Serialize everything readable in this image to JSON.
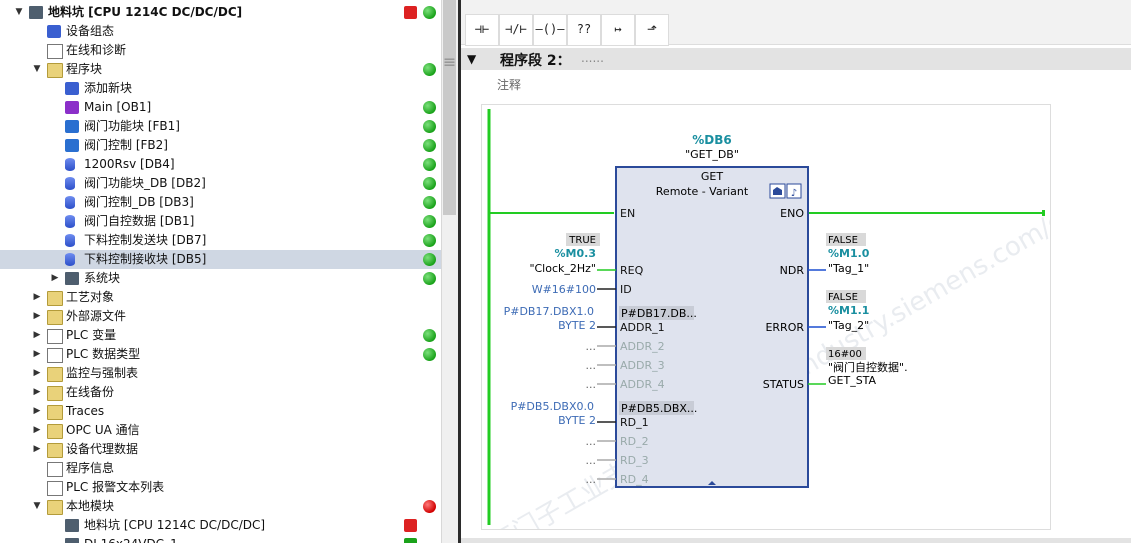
{
  "tree": {
    "items": [
      {
        "label": "地料坑 [CPU 1214C DC/DC/DC]",
        "bold": true,
        "indent": 0,
        "expand": "open",
        "icon": "cpu-icon",
        "status": "green",
        "extra": "download-icon"
      },
      {
        "label": "设备组态",
        "indent": 1,
        "icon": "device-config-icon"
      },
      {
        "label": "在线和诊断",
        "indent": 1,
        "icon": "online-diagnostics-icon"
      },
      {
        "label": "程序块",
        "indent": 1,
        "expand": "open",
        "icon": "folder-icon",
        "status": "green"
      },
      {
        "label": "添加新块",
        "indent": 2,
        "icon": "add-block-icon"
      },
      {
        "label": "Main [OB1]",
        "indent": 2,
        "icon": "ob-icon",
        "status": "green"
      },
      {
        "label": "阀门功能块 [FB1]",
        "indent": 2,
        "icon": "fb-icon",
        "status": "green"
      },
      {
        "label": "阀门控制 [FB2]",
        "indent": 2,
        "icon": "fb-icon",
        "status": "green"
      },
      {
        "label": "1200Rsv [DB4]",
        "indent": 2,
        "icon": "db-icon",
        "status": "green"
      },
      {
        "label": "阀门功能块_DB [DB2]",
        "indent": 2,
        "icon": "db-icon",
        "status": "green"
      },
      {
        "label": "阀门控制_DB [DB3]",
        "indent": 2,
        "icon": "db-icon",
        "status": "green"
      },
      {
        "label": "阀门自控数据 [DB1]",
        "indent": 2,
        "icon": "db-icon",
        "status": "green"
      },
      {
        "label": "下料控制发送块 [DB7]",
        "indent": 2,
        "icon": "db-icon",
        "status": "green"
      },
      {
        "label": "下料控制接收块 [DB5]",
        "indent": 2,
        "icon": "db-icon",
        "status": "green",
        "selected": true
      },
      {
        "label": "系统块",
        "indent": 2,
        "expand": "closed",
        "icon": "system-block-icon",
        "status": "green"
      },
      {
        "label": "工艺对象",
        "indent": 1,
        "expand": "closed",
        "icon": "folder-icon"
      },
      {
        "label": "外部源文件",
        "indent": 1,
        "expand": "closed",
        "icon": "folder-icon"
      },
      {
        "label": "PLC 变量",
        "indent": 1,
        "expand": "closed",
        "icon": "plc-tags-icon",
        "status": "green"
      },
      {
        "label": "PLC 数据类型",
        "indent": 1,
        "expand": "closed",
        "icon": "plc-datatype-icon",
        "status": "green"
      },
      {
        "label": "监控与强制表",
        "indent": 1,
        "expand": "closed",
        "icon": "folder-icon"
      },
      {
        "label": "在线备份",
        "indent": 1,
        "expand": "closed",
        "icon": "folder-icon"
      },
      {
        "label": "Traces",
        "indent": 1,
        "expand": "closed",
        "icon": "folder-icon"
      },
      {
        "label": "OPC UA 通信",
        "indent": 1,
        "expand": "closed",
        "icon": "folder-icon"
      },
      {
        "label": "设备代理数据",
        "indent": 1,
        "expand": "closed",
        "icon": "folder-icon"
      },
      {
        "label": "程序信息",
        "indent": 1,
        "icon": "program-info-icon"
      },
      {
        "label": "PLC 报警文本列表",
        "indent": 1,
        "icon": "doc-icon"
      },
      {
        "label": "本地模块",
        "indent": 1,
        "expand": "open",
        "icon": "folder-icon",
        "status": "red"
      },
      {
        "label": "地料坑 [CPU 1214C DC/DC/DC]",
        "indent": 2,
        "icon": "cpu-icon",
        "extra": "download-icon"
      },
      {
        "label": "DI 16x24VDC_1",
        "indent": 2,
        "icon": "module-icon",
        "extra": "check-icon"
      }
    ]
  },
  "toolbar": {
    "buttons": [
      {
        "name": "no-contact-button",
        "glyph": "⊣⊢"
      },
      {
        "name": "nc-contact-button",
        "glyph": "⊣/⊢"
      },
      {
        "name": "coil-button",
        "glyph": "–()–"
      },
      {
        "name": "empty-box-button",
        "glyph": "??"
      },
      {
        "name": "open-branch-button",
        "glyph": "↦"
      },
      {
        "name": "close-branch-button",
        "glyph": "⬏"
      }
    ]
  },
  "network": {
    "title": "程序段 2：",
    "dots": "......",
    "comment": "注释"
  },
  "block": {
    "db": "%DB6",
    "db_name": "\"GET_DB\"",
    "type": "GET",
    "subtitle": "Remote - Variant",
    "pins_left": [
      "EN",
      "REQ",
      "ID",
      "ADDR_1",
      "ADDR_2",
      "ADDR_3",
      "ADDR_4",
      "RD_1",
      "RD_2",
      "RD_3",
      "RD_4"
    ],
    "pins_right": [
      "ENO",
      "NDR",
      "ERROR",
      "STATUS"
    ],
    "req_value": "TRUE",
    "req_addr": "%M0.3",
    "req_tag": "\"Clock_2Hz\"",
    "id_value": "W#16#100",
    "addr1_addr": "P#DB17.DBX1.0",
    "addr1_type": "BYTE 2",
    "addr1_box": "P#DB17.DB...",
    "rd1_addr": "P#DB5.DBX0.0",
    "rd1_type": "BYTE 2",
    "rd1_box": "P#DB5.DBX...",
    "ellipsis": "...",
    "ndr_value": "FALSE",
    "ndr_addr": "%M1.0",
    "ndr_tag": "\"Tag_1\"",
    "error_value": "FALSE",
    "error_addr": "%M1.1",
    "error_tag": "\"Tag_2\"",
    "status_value": "16#00",
    "status_tag1": "\"阀门自控数据\".",
    "status_tag2": "GET_STA"
  },
  "watermark": "西门子工业支持中心 support.industry.siemens.com/cs",
  "colors": {
    "accent": "#1ab21a",
    "teal": "#1a8fa0",
    "blue_value": "#3d6bb5",
    "rung": "#22cc22"
  }
}
